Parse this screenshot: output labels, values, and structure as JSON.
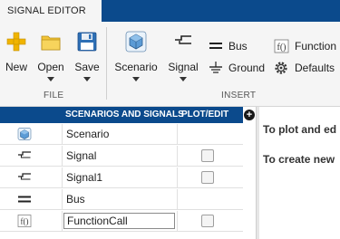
{
  "tabs": {
    "active": "SIGNAL EDITOR"
  },
  "ribbon": {
    "file": {
      "new": "New",
      "open": "Open",
      "save": "Save",
      "group": "FILE"
    },
    "insert": {
      "scenario": "Scenario",
      "signal": "Signal",
      "bus": "Bus",
      "ground": "Ground",
      "function_call": "Function C",
      "defaults": "Defaults",
      "group": "INSERT"
    }
  },
  "table": {
    "headers": {
      "name": "SCENARIOS AND SIGNALS",
      "plot": "PLOT/EDIT"
    },
    "add_icon": "plus-circle-icon",
    "rows": [
      {
        "icon": "scenario-icon",
        "name": "Scenario",
        "has_checkbox": false
      },
      {
        "icon": "signal-icon",
        "name": "Signal",
        "has_checkbox": true
      },
      {
        "icon": "signal-icon",
        "name": "Signal1",
        "has_checkbox": true
      },
      {
        "icon": "bus-icon",
        "name": "Bus",
        "has_checkbox": false
      },
      {
        "icon": "function-call-icon",
        "name": "FunctionCall",
        "has_checkbox": true,
        "editing": true
      }
    ]
  },
  "hints": {
    "line1": "To plot and ed",
    "line2": "To create new"
  },
  "colors": {
    "header_blue": "#0b4a8c",
    "folder_yellow": "#f2c438",
    "save_blue": "#2e6fb5"
  }
}
